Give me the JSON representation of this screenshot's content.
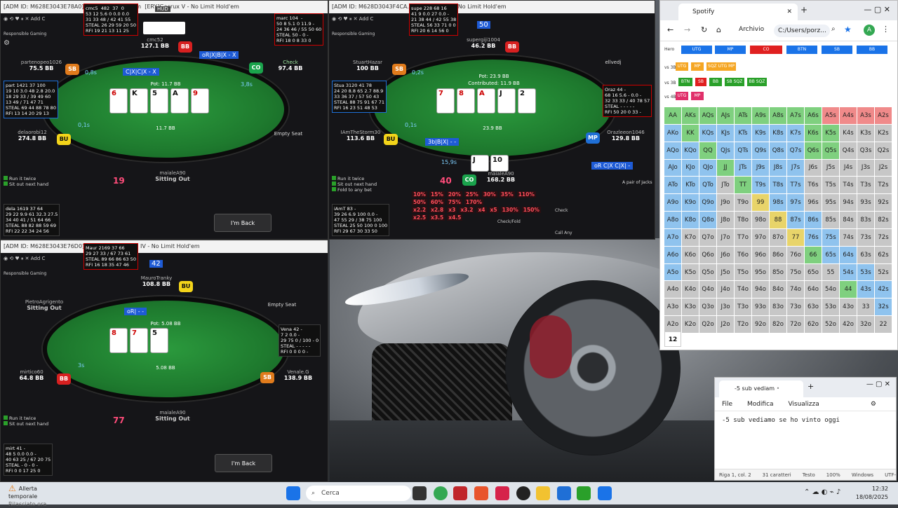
{
  "tables": {
    "t1": {
      "title": "[ADM ID: M628E3043E78A0] ... No Limit Hold'em",
      "title_right": "[ERY]Gacrux V - No Limit Hold'em",
      "hud_label": "HUD",
      "responsible": "Responsible Gaming",
      "seats": {
        "top": {
          "name": "cmc52",
          "stack": "127.1 BB"
        },
        "top_right": {
          "name": "",
          "stack": "97.4 BB",
          "action": "Check"
        },
        "left": {
          "name": "partenopeo1026",
          "stack": "75.5 BB",
          "timer": "0,8s"
        },
        "right_timer": "3,8s",
        "bottom_left": {
          "name": "delaorobi12",
          "stack": "274.8 BB",
          "timer": "0,1s"
        },
        "bottom_right": {
          "name": "Empty Seat"
        },
        "hero": {
          "name": "maialeA90",
          "status": "Sitting Out"
        }
      },
      "pot": "Pot: 11.7 BB",
      "pot_center": "11.7 BB",
      "action_tag": "C|X|C|X - X",
      "top_action_tag": "oR|X|B|X - X",
      "cards": [
        "6",
        "K",
        "5",
        "A",
        "9"
      ],
      "table_num": "19",
      "run_it_twice": "Run it twice",
      "sit_out": "Sit out next hand",
      "back": "I'm Back",
      "hud_tl": "cmc5  482  37  0\n53 12 5.6 0 0.0 0.0\n31 33 48 / 42 41 55\nSTEAL 26 29 59 20 50\nRFI 19 21 13 11 25",
      "hud_tr": "marc 104  -\n50 8 5.1 0 11.9 -\n24 36 46 / 55 50 60\nSTEAL 50 - 0 -\nRFI 18 0 8 33 0",
      "hud_left": "part 1421 37 100\n19 10 3.0 48 2.8 20.0\n18 29 33 / 39 49 60\n13 49 / 71 47 71\nSTEAL 69 44 88 78 80\nRFI 13 14 20 29 13",
      "hud_bl": "dela 1619 37 64\n29 22 9.9 61 32.3 27.5\n34 40 41 / 51 64 66\nSTEAL 88 82 88 59 69\nRFI 22 22 34 24 56"
    },
    "t2": {
      "title": "[ADM ID: M628D3043F4CA...] ...Numidia IV - No Limit Hold'em",
      "seats": {
        "top": {
          "name": "supergiji1004",
          "stack": "46.2 BB",
          "num": "50"
        },
        "left": {
          "name": "StuartHazar",
          "stack": "100 BB",
          "timer": "0,2s"
        },
        "right": {
          "name": "ellvedj",
          "stack": ""
        },
        "bottom_left": {
          "name": "IAmTheStorm30",
          "stack": "113.6 BB",
          "timer": "0,1s"
        },
        "mp": {
          "name": "Orazleeon1046",
          "stack": "129.8 BB"
        },
        "hero": {
          "name": "maialeA90",
          "stack": "168.2 BB",
          "timer": "15,9s"
        }
      },
      "pot": "Pot: 23.9 BB",
      "contributed": "Contributed: 11.9 BB",
      "pot_center": "23.9 BB",
      "action_tag": "3b|B|X| - -",
      "mp_action": "oR C|X C|X| -",
      "cards": [
        "7",
        "8",
        "A",
        "J",
        "2"
      ],
      "hero_cards": [
        "J",
        "10"
      ],
      "table_num": "40",
      "hand_label": "A pair of Jacks",
      "sizes_row1": [
        "10%",
        "15%",
        "20%",
        "25%",
        "30%",
        "35%",
        "110%"
      ],
      "sizes_row2": [
        "50%",
        "60%",
        "75%",
        "170%"
      ],
      "sizes_row3": [
        "x2.2",
        "x2.8",
        "x3",
        "x3.2",
        "x4",
        "x5",
        "130%",
        "150%"
      ],
      "sizes_row4": [
        "x2.5",
        "x3.5",
        "x4.5"
      ],
      "check": "Check",
      "checkfold": "Check/Fold",
      "callany": "Call Any",
      "fold_any": "Fold to any bet",
      "hud_top": "supe 228 68 16\n41 9 0.0 27 0.0 -\n21 38 44 / 42 55 38\nSTEAL 56 33 71 0 0\nRFI 20 6 14 56 0",
      "hud_left": "Stua 3120 41 78\n24 20 8.8 65 2.7 88.9\n33 36 37 / 57 50 43\nSTEAL 88 75 91 67 71\nRFI 16 23 51 48 53",
      "hud_right": "Oraz 44 -\n68 16 5.6 - 0.0 -\n32 33 33 / 40 78 57\nSTEAL - - - - -\nRFI 50 20 0 33 -",
      "hud_bl": "iAmT 83 -\n39 26 6.9 100 0.0 -\n47 55 29 / 38 75 100\nSTEAL 25 50 100 0 100\nRFI 29 67 30 33 50"
    },
    "t3": {
      "title": "[ADM ID: M628E3043E76D0] ...[DTD]Interamnia IV - No Limit Hold'em",
      "seats": {
        "top": {
          "name": "MauroTranky",
          "stack": "108.8 BB",
          "num": "42"
        },
        "left": {
          "name": "PietroAgrigento",
          "status": "Sitting Out"
        },
        "right": {
          "name": "Empty Seat"
        },
        "right_low": {
          "name": "Venale.G",
          "stack": "138.9 BB"
        },
        "bottom_left": {
          "name": "mirtico60",
          "stack": "64.8 BB",
          "timer": "3s"
        },
        "hero": {
          "name": "maialeA90",
          "status": "Sitting Out"
        }
      },
      "pot": "Pot: 5.08 BB",
      "pot_center": "5.08 BB",
      "action_tag": "oR| - -",
      "cards": [
        "8",
        "7",
        "5"
      ],
      "table_num": "77",
      "hud_top": "Maur 2169 37 66\n29 27 33 / 67 73 61\nSTEAL 89 66 86 63 50\nRFI 16 18 35 47 46",
      "hud_right": "Vena 42 -\n7 2 0.0 -\n29 75 0 / 100 - 0\nSTEAL - - - - -\nRFI 0 0 0 0 -",
      "hud_bl": "mirt 41 -\n48 5 0.0 0.0 -\n40 63 25 / 67 20 75\nSTEAL - 0 - 0 -\nRFI 0 0 17 25 0"
    }
  },
  "chrome": {
    "tab_title": "Spotify",
    "archivio": "Archivio",
    "url": "C:/Users/porz...",
    "positions": [
      "Hero",
      "UTG",
      "MP",
      "CO",
      "BTN",
      "SB",
      "BB"
    ],
    "vs_rows": [
      {
        "label": "vs 3B",
        "btns": [
          "UTG",
          "MP",
          "SQZ UTG MP"
        ]
      },
      {
        "label": "vs 3B",
        "btns": [
          "BTN",
          "SB",
          "BB",
          "SB SQZ",
          "BB SQZ"
        ]
      },
      {
        "label": "vs 4B",
        "btns": [
          "UTG",
          "MP"
        ]
      }
    ],
    "counter": "12",
    "matrix": [
      [
        "AA",
        "AKs",
        "AQs",
        "AJs",
        "ATs",
        "A9s",
        "A8s",
        "A7s",
        "A6s",
        "A5s",
        "A4s",
        "A3s",
        "A2s"
      ],
      [
        "AKo",
        "KK",
        "KQs",
        "KJs",
        "KTs",
        "K9s",
        "K8s",
        "K7s",
        "K6s",
        "K5s",
        "K4s",
        "K3s",
        "K2s"
      ],
      [
        "AQo",
        "KQo",
        "QQ",
        "QJs",
        "QTs",
        "Q9s",
        "Q8s",
        "Q7s",
        "Q6s",
        "Q5s",
        "Q4s",
        "Q3s",
        "Q2s"
      ],
      [
        "AJo",
        "KJo",
        "QJo",
        "JJ",
        "JTs",
        "J9s",
        "J8s",
        "J7s",
        "J6s",
        "J5s",
        "J4s",
        "J3s",
        "J2s"
      ],
      [
        "ATo",
        "KTo",
        "QTo",
        "JTo",
        "TT",
        "T9s",
        "T8s",
        "T7s",
        "T6s",
        "T5s",
        "T4s",
        "T3s",
        "T2s"
      ],
      [
        "A9o",
        "K9o",
        "Q9o",
        "J9o",
        "T9o",
        "99",
        "98s",
        "97s",
        "96s",
        "95s",
        "94s",
        "93s",
        "92s"
      ],
      [
        "A8o",
        "K8o",
        "Q8o",
        "J8o",
        "T8o",
        "98o",
        "88",
        "87s",
        "86s",
        "85s",
        "84s",
        "83s",
        "82s"
      ],
      [
        "A7o",
        "K7o",
        "Q7o",
        "J7o",
        "T7o",
        "97o",
        "87o",
        "77",
        "76s",
        "75s",
        "74s",
        "73s",
        "72s"
      ],
      [
        "A6o",
        "K6o",
        "Q6o",
        "J6o",
        "T6o",
        "96o",
        "86o",
        "76o",
        "66",
        "65s",
        "64s",
        "63s",
        "62s"
      ],
      [
        "A5o",
        "K5o",
        "Q5o",
        "J5o",
        "T5o",
        "95o",
        "85o",
        "75o",
        "65o",
        "55",
        "54s",
        "53s",
        "52s"
      ],
      [
        "A4o",
        "K4o",
        "Q4o",
        "J4o",
        "T4o",
        "94o",
        "84o",
        "74o",
        "64o",
        "54o",
        "44",
        "43s",
        "42s"
      ],
      [
        "A3o",
        "K3o",
        "Q3o",
        "J3o",
        "T3o",
        "93o",
        "83o",
        "73o",
        "63o",
        "53o",
        "43o",
        "33",
        "32s"
      ],
      [
        "A2o",
        "K2o",
        "Q2o",
        "J2o",
        "T2o",
        "92o",
        "82o",
        "72o",
        "62o",
        "52o",
        "42o",
        "32o",
        "22"
      ]
    ]
  },
  "notepad": {
    "tab": "-5 sub vediam",
    "menu": [
      "File",
      "Modifica",
      "Visualizza"
    ],
    "text": "-5 sub vediamo se ho vinto oggi",
    "status": [
      "Riga 1, col. 2",
      "31 caratteri",
      "Testo",
      "100%",
      "Windows",
      "UTF-8"
    ]
  },
  "taskbar": {
    "weather_title": "Allerta temporale",
    "weather_sub": "Rilasciato ora",
    "search": "Cerca",
    "time": "12:32",
    "date": "18/08/2025"
  }
}
